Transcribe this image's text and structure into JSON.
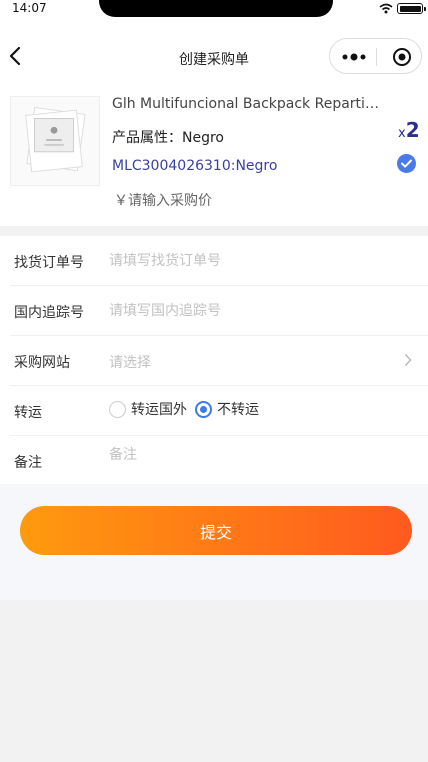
{
  "status": {
    "time": "14:07"
  },
  "nav": {
    "title": "创建采购单"
  },
  "product": {
    "title": "Glh Multifuncional Backpack Repartido Para Mujer",
    "attribute": "产品属性：Negro",
    "sku": "MLC3004026310:Negro",
    "qty_prefix": "x",
    "qty": "2",
    "price_placeholder": "￥请输入采购价"
  },
  "form": {
    "order_no": {
      "label": "找货订单号",
      "placeholder": "请填写找货订单号"
    },
    "tracking_no": {
      "label": "国内追踪号",
      "placeholder": "请填写国内追踪号"
    },
    "site": {
      "label": "采购网站",
      "value": "请选择"
    },
    "transship": {
      "label": "转运",
      "option_abroad": "转运国外",
      "option_none": "不转运",
      "selected": "不转运"
    },
    "remark": {
      "label": "备注",
      "placeholder": "备注"
    }
  },
  "submit": {
    "label": "提交",
    "gradient_from": "#ff9a0e",
    "gradient_to": "#ff5a1f"
  },
  "colors": {
    "accent": "#3d7be8",
    "sku": "#3b3fa0",
    "check": "#4a7ae8"
  }
}
